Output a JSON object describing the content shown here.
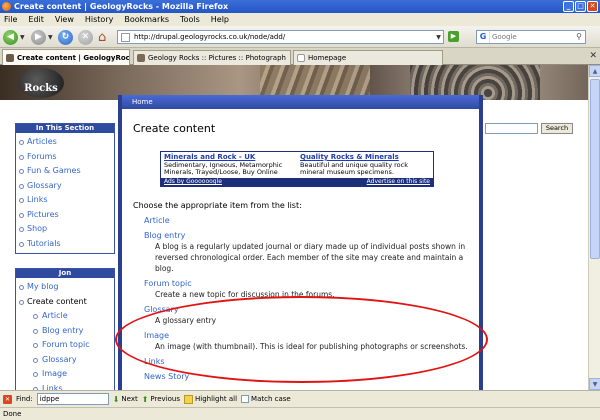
{
  "window": {
    "title": "Create content | GeologyRocks - Mozilla Firefox"
  },
  "menu": [
    "File",
    "Edit",
    "View",
    "History",
    "Bookmarks",
    "Tools",
    "Help"
  ],
  "nav": {
    "url": "http://drupal.geologyrocks.co.uk/node/add/",
    "search_placeholder": "Google"
  },
  "tabs": [
    {
      "label": "Create content | GeologyRocks",
      "active": true
    },
    {
      "label": "Geology Rocks :: Pictures :: Photograph",
      "active": false
    },
    {
      "label": "Homepage",
      "active": false
    }
  ],
  "site": {
    "logo_text": "Rocks"
  },
  "sidebar": {
    "section_title": "In This Section",
    "section_items": [
      "Articles",
      "Forums",
      "Fun & Games",
      "Glossary",
      "Links",
      "Pictures",
      "Shop",
      "Tutorials"
    ],
    "user_title": "Jon",
    "user_items": [
      {
        "label": "My blog",
        "current": false,
        "sub": false
      },
      {
        "label": "Create content",
        "current": true,
        "sub": false
      },
      {
        "label": "Article",
        "current": false,
        "sub": true
      },
      {
        "label": "Blog entry",
        "current": false,
        "sub": true
      },
      {
        "label": "Forum topic",
        "current": false,
        "sub": true
      },
      {
        "label": "Glossary",
        "current": false,
        "sub": true
      },
      {
        "label": "Image",
        "current": false,
        "sub": true
      },
      {
        "label": "Links",
        "current": false,
        "sub": true
      }
    ]
  },
  "main": {
    "breadcrumb": "Home",
    "title": "Create content",
    "choose_text": "Choose the appropriate item from the list:",
    "content_types": [
      {
        "name": "Article",
        "description": ""
      },
      {
        "name": "Blog entry",
        "description": "A blog is a regularly updated journal or diary made up of individual posts shown in reversed chronological order. Each member of the site may create and maintain a blog."
      },
      {
        "name": "Forum topic",
        "description": "Create a new topic for discussion in the forums."
      },
      {
        "name": "Glossary",
        "description": "A glossary entry"
      },
      {
        "name": "Image",
        "description": "An image (with thumbnail). This is ideal for publishing photographs or screenshots."
      },
      {
        "name": "Links",
        "description": ""
      },
      {
        "name": "News Story",
        "description": ""
      }
    ]
  },
  "ads": {
    "items": [
      {
        "title": "Minerals and Rock - UK",
        "line1": "Sedimentary, Igneous, Metamorphic",
        "line2": "Minerals, Trayed/Loose, Buy Online"
      },
      {
        "title": "Quality Rocks & Minerals",
        "line1": "Beautiful and unique quality rock",
        "line2": "mineral museum specimens."
      }
    ],
    "footer_left": "Ads by Goooooogle",
    "footer_right": "Advertise on this site"
  },
  "right_search": {
    "button": "Search"
  },
  "findbar": {
    "label": "Find:",
    "value": "idppe",
    "next": "Next",
    "previous": "Previous",
    "highlight": "Highlight all",
    "match_case": "Match case"
  },
  "status": {
    "text": "Done"
  },
  "colors": {
    "accent_blue": "#2f4ba0",
    "highlight_red": "#e11414",
    "link_blue": "#3366cc"
  }
}
